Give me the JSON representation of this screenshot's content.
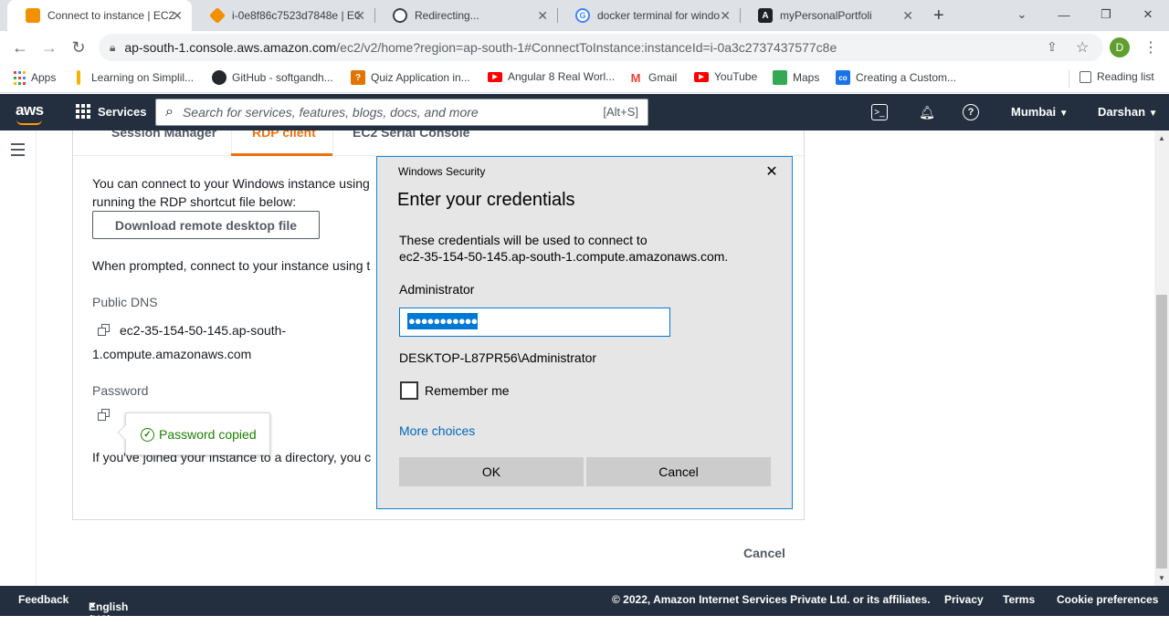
{
  "browser": {
    "tabs": [
      {
        "title": "Connect to instance | EC2",
        "active": true,
        "favicon_color": "#f29100"
      },
      {
        "title": "i-0e8f86c7523d7848e | EC",
        "active": false,
        "favicon_color": "#f29100"
      },
      {
        "title": "Redirecting...",
        "active": false,
        "favicon_color": "#3c4043"
      },
      {
        "title": "docker terminal for windo",
        "active": false,
        "favicon_color": "#4285f4"
      },
      {
        "title": "myPersonalPortfoli",
        "active": false,
        "favicon_color": "#202124"
      }
    ],
    "url_host": "ap-south-1.console.aws.amazon.com",
    "url_path": "/ec2/v2/home?region=ap-south-1#ConnectToInstance:instanceId=i-0a3c2737437577c8e",
    "profile_initial": "D",
    "bookmarks": [
      {
        "label": "Apps",
        "icon": "apps-grid-icon",
        "color": "#ea4335"
      },
      {
        "label": "Learning on Simplil...",
        "icon": "simplilearn-icon",
        "color": "#f4b400"
      },
      {
        "label": "GitHub - softgandh...",
        "icon": "github-icon",
        "color": "#24292e"
      },
      {
        "label": "Quiz Application in...",
        "icon": "quiz-icon",
        "color": "#e37400"
      },
      {
        "label": "Angular 8 Real Worl...",
        "icon": "youtube-icon",
        "color": "#ff0000"
      },
      {
        "label": "Gmail",
        "icon": "gmail-icon",
        "color": "#ea4335"
      },
      {
        "label": "YouTube",
        "icon": "youtube-icon",
        "color": "#ff0000"
      },
      {
        "label": "Maps",
        "icon": "maps-icon",
        "color": "#34a853"
      },
      {
        "label": "Creating a Custom...",
        "icon": "colab-icon",
        "color": "#1a73e8"
      }
    ],
    "reading_list": "Reading list"
  },
  "aws_nav": {
    "logo": "aws",
    "services": "Services",
    "search_placeholder": "Search for services, features, blogs, docs, and more",
    "search_shortcut": "[Alt+S]",
    "region": "Mumbai",
    "user": "Darshan"
  },
  "connect": {
    "tabs": [
      "Session Manager",
      "RDP client",
      "EC2 Serial Console"
    ],
    "intro": "You can connect to your Windows instance using",
    "intro2": "running the RDP shortcut file below:",
    "download_button": "Download remote desktop file",
    "prompt_text": "When prompted, connect to your instance using t",
    "public_dns_label": "Public DNS",
    "public_dns_line1": "ec2-35-154-50-145.ap-south-",
    "public_dns_line2": "1.compute.amazonaws.com",
    "password_label": "Password",
    "popover_msg": "Password copied",
    "directory_text": "If you've joined your instance to a directory, you c",
    "cancel": "Cancel"
  },
  "dialog": {
    "window_title": "Windows Security",
    "heading": "Enter your credentials",
    "desc1": "These credentials will be used to connect to",
    "desc2": "ec2-35-154-50-145.ap-south-1.compute.amazonaws.com.",
    "username": "Administrator",
    "password_mask": "●●●●●●●●●●●",
    "domain_user": "DESKTOP-L87PR56\\Administrator",
    "remember_me": "Remember me",
    "remember_checked": false,
    "more_choices": "More choices",
    "ok": "OK",
    "cancel": "Cancel"
  },
  "footer": {
    "feedback": "Feedback",
    "language": "English (US)",
    "copyright": "© 2022, Amazon Internet Services Private Ltd. or its affiliates.",
    "privacy": "Privacy",
    "terms": "Terms",
    "cookies": "Cookie preferences"
  }
}
